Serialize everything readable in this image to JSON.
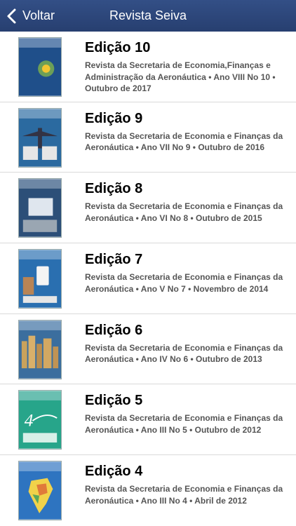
{
  "navbar": {
    "back_label": "Voltar",
    "title": "Revista Seiva"
  },
  "issues": [
    {
      "title": "Edição 10",
      "description": "Revista da Secretaria de Economia,Finanças e Administração da Aeronáutica • Ano VIII No 10 • Outubro de 2017",
      "cover_color": "#1f4f8a"
    },
    {
      "title": "Edição 9",
      "description": "Revista da Secretaria de Economia e Finanças da Aeronáutica • Ano VII No 9 • Outubro de 2016",
      "cover_color": "#2b6aa0"
    },
    {
      "title": "Edição 8",
      "description": "Revista da Secretaria de Economia e Finanças da Aeronáutica • Ano VI No 8 • Outubro de 2015",
      "cover_color": "#2c4f78"
    },
    {
      "title": "Edição 7",
      "description": "Revista da Secretaria de Economia e Finanças da Aeronáutica • Ano V No 7 • Novembro de 2014",
      "cover_color": "#2a6fb0"
    },
    {
      "title": "Edição 6",
      "description": "Revista da Secretaria de Economia e Finanças da Aeronáutica • Ano IV No 6 • Outubro de 2013",
      "cover_color": "#3b6e9e"
    },
    {
      "title": "Edição 5",
      "description": "Revista da Secretaria de Economia e Finanças da Aeronáutica • Ano III No 5 • Outubro de 2012",
      "cover_color": "#27a58a"
    },
    {
      "title": "Edição 4",
      "description": "Revista da Secretaria de Economia e Finanças da Aeronáutica • Ano III No 4 • Abril de 2012",
      "cover_color": "#2e74c0"
    }
  ]
}
